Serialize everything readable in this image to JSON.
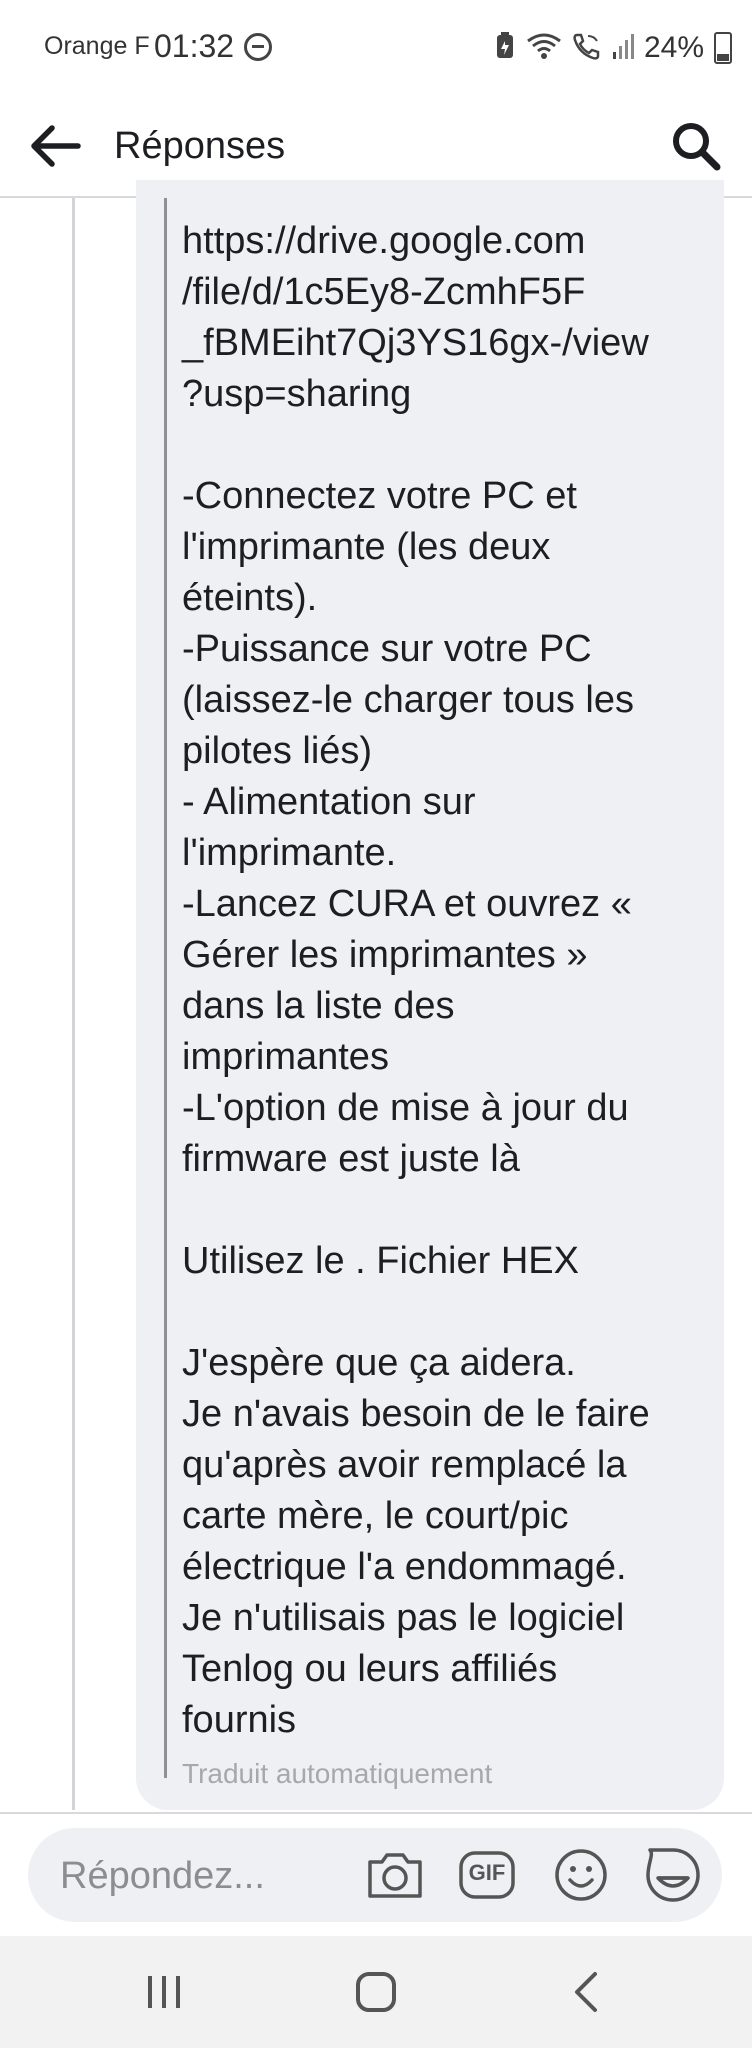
{
  "status_bar": {
    "carrier": "Orange F",
    "time": "01:32",
    "battery": "24%",
    "icons": [
      "do-not-disturb-icon",
      "battery-saver-icon",
      "wifi-icon",
      "wifi-calling-icon",
      "signal-icon",
      "battery-icon"
    ]
  },
  "app_bar": {
    "title": "Réponses",
    "back_icon": "arrow-left-icon",
    "search_icon": "search-icon"
  },
  "message": {
    "lines": [
      "https://drive.google.com",
      "/file/d/1c5Ey8-ZcmhF5F",
      "_fBMEiht7Qj3YS16gx-/view",
      "?usp=sharing",
      "",
      "-Connectez votre PC et",
      "l'imprimante (les deux",
      "éteints).",
      "-Puissance sur votre PC",
      "(laissez-le charger tous les",
      "pilotes liés)",
      "- Alimentation sur",
      "l'imprimante.",
      "-Lancez CURA et ouvrez «",
      "Gérer les imprimantes »",
      "dans la liste des",
      "imprimantes",
      "-L'option de mise à jour du",
      "firmware est juste là",
      "",
      "Utilisez le . Fichier HEX",
      "",
      "J'espère que ça aidera.",
      "Je n'avais besoin de le faire",
      "qu'après avoir remplacé la",
      "carte mère, le court/pic",
      "électrique l'a endommagé.",
      "Je n'utilisais pas le logiciel",
      "Tenlog ou leurs affiliés",
      "fournis"
    ],
    "translated_label": "Traduit automatiquement"
  },
  "composer": {
    "placeholder": "Répondez...",
    "value": "",
    "gif_label": "GIF",
    "icons": [
      "camera-icon",
      "gif-icon",
      "emoji-icon",
      "sticker-icon"
    ]
  },
  "nav_bar": {
    "icons": [
      "recent-apps-icon",
      "home-icon",
      "back-icon"
    ]
  }
}
